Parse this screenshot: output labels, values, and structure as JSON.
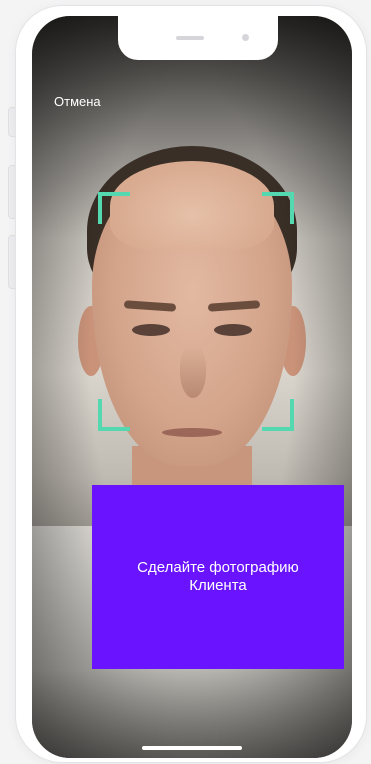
{
  "screen": {
    "cancel_label": "Отмена",
    "prompt_text": "Сделайте фотографию\nКлиента"
  },
  "colors": {
    "accent": "#6a13ff",
    "frame": "#54d8b0"
  },
  "icons": {
    "speaker": "speaker-grille-icon",
    "camera": "front-camera-icon"
  }
}
